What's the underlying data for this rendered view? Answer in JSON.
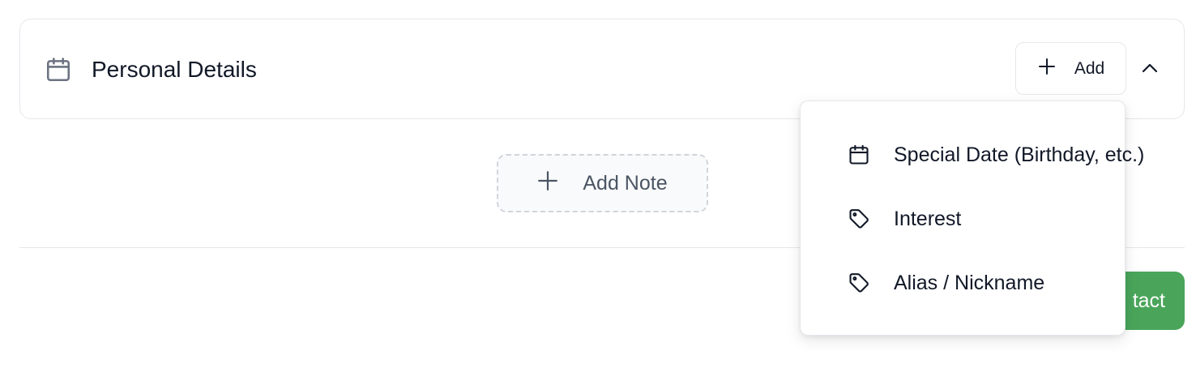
{
  "section": {
    "title": "Personal Details",
    "icon": "calendar-icon",
    "add_label": "Add"
  },
  "add_note": {
    "label": "Add Note"
  },
  "footer": {
    "primary_button_label": "tact",
    "primary_button_color": "#4aa55a"
  },
  "dropdown": {
    "items": [
      {
        "label": "Special Date (Birthday, etc.)",
        "icon": "calendar-icon"
      },
      {
        "label": "Interest",
        "icon": "tag-icon"
      },
      {
        "label": "Alias / Nickname",
        "icon": "tag-icon"
      }
    ]
  }
}
